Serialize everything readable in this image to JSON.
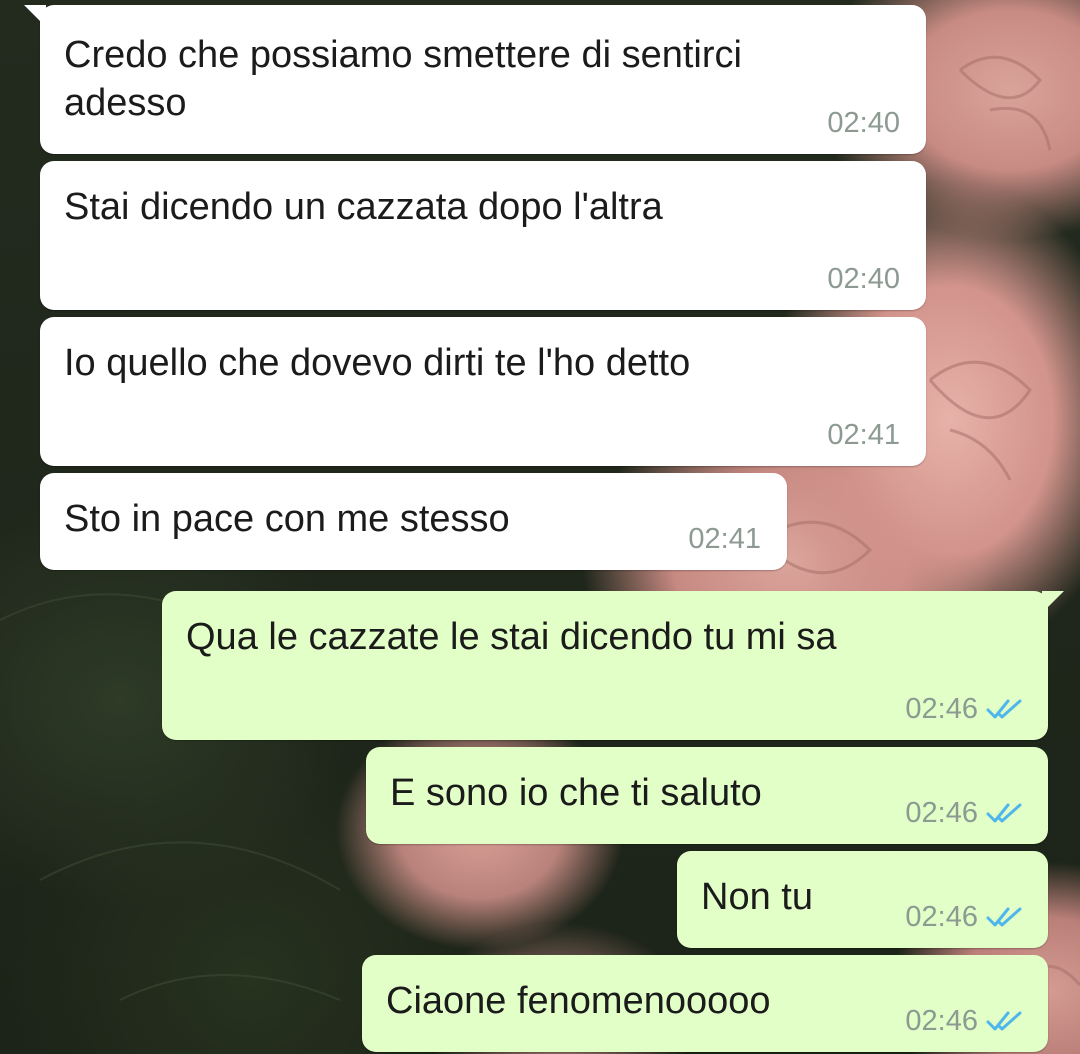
{
  "colors": {
    "incoming_bubble": "#ffffff",
    "outgoing_bubble": "#e2ffc7",
    "read_ticks": "#4fb6ec",
    "timestamp": "#8c9a92"
  },
  "messages": [
    {
      "direction": "incoming",
      "text": "Credo che possiamo smettere di sentirci\nadesso",
      "time": "02:40"
    },
    {
      "direction": "incoming",
      "text": "Stai dicendo un cazzata dopo l'altra",
      "time": "02:40"
    },
    {
      "direction": "incoming",
      "text": "Io quello che dovevo dirti te l'ho detto",
      "time": "02:41"
    },
    {
      "direction": "incoming",
      "text": "Sto in pace con me stesso",
      "time": "02:41"
    },
    {
      "direction": "outgoing",
      "text": "Qua le cazzate le stai dicendo tu mi sa",
      "time": "02:46",
      "status_icon": "double-check-read-icon"
    },
    {
      "direction": "outgoing",
      "text": "E sono io che ti saluto",
      "time": "02:46",
      "status_icon": "double-check-read-icon"
    },
    {
      "direction": "outgoing",
      "text": "Non tu",
      "time": "02:46",
      "status_icon": "double-check-read-icon"
    },
    {
      "direction": "outgoing",
      "text": "Ciaone fenomenooooo",
      "time": "02:46",
      "status_icon": "double-check-read-icon"
    }
  ]
}
